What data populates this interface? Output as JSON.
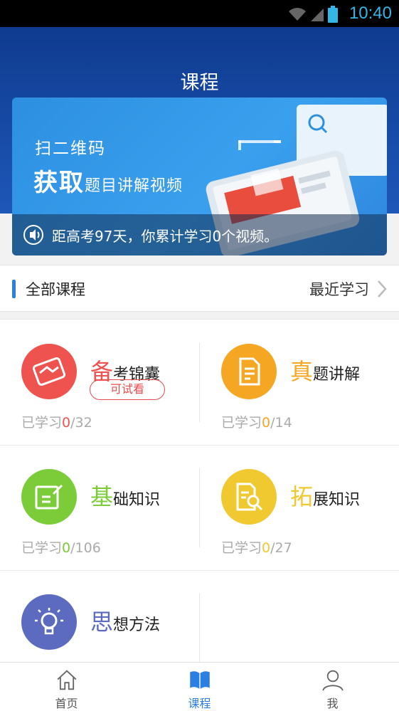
{
  "status_bar": {
    "time": "10:40"
  },
  "header": {
    "title": "课程"
  },
  "banner": {
    "line1": "扫二维码",
    "line2_big": "获取",
    "line2_small": "题目讲解视频",
    "notice": "距高考97天，你累计学习0个视频。"
  },
  "section": {
    "label": "全部课程",
    "recent": "最近学习"
  },
  "courses": [
    {
      "first": "备",
      "rest": "考锦囊",
      "progress_prefix": "已学习",
      "done": "0",
      "total": "/32",
      "color": "#ef5350",
      "badge": "可试看",
      "icon": "handshake-icon"
    },
    {
      "first": "真",
      "rest": "题讲解",
      "progress_prefix": "已学习",
      "done": "0",
      "total": "/14",
      "color": "#f5a623",
      "icon": "document-icon"
    },
    {
      "first": "基",
      "rest": "础知识",
      "progress_prefix": "已学习",
      "done": "0",
      "total": "/106",
      "color": "#7ccc3a",
      "icon": "edit-icon"
    },
    {
      "first": "拓",
      "rest": "展知识",
      "progress_prefix": "已学习",
      "done": "0",
      "total": "/27",
      "color": "#f0c930",
      "icon": "search-doc-icon"
    },
    {
      "first": "思",
      "rest": "想方法",
      "color": "#5c6bc0",
      "icon": "lightbulb-icon"
    }
  ],
  "tabs": [
    {
      "label": "首页",
      "icon": "home-icon"
    },
    {
      "label": "课程",
      "icon": "book-icon",
      "active": true
    },
    {
      "label": "我",
      "icon": "person-icon"
    }
  ]
}
